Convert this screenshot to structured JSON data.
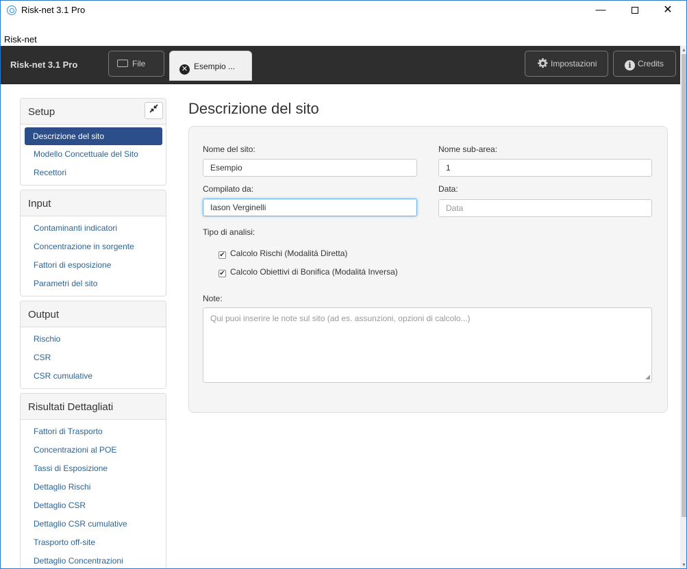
{
  "window": {
    "title": "Risk-net 3.1 Pro",
    "minimize": "—",
    "close": "✕"
  },
  "menubar": {
    "label": "Risk-net"
  },
  "toolbar": {
    "brand": "Risk-net 3.1 Pro",
    "file_label": "File",
    "active_tab_label": "Esempio ...",
    "settings_label": "Impostazioni",
    "credits_label": "Credits"
  },
  "sidebar": {
    "collapse_icon": "compress-arrows-icon",
    "panels": [
      {
        "title": "Setup",
        "items": [
          "Descrizione del sito",
          "Modello Concettuale del Sito",
          "Recettori"
        ]
      },
      {
        "title": "Input",
        "items": [
          "Contaminanti indicatori",
          "Concentrazione in sorgente",
          "Fattori di esposizione",
          "Parametri del sito"
        ]
      },
      {
        "title": "Output",
        "items": [
          "Rischio",
          "CSR",
          "CSR cumulative"
        ]
      },
      {
        "title": "Risultati Dettagliati",
        "items": [
          "Fattori di Trasporto",
          "Concentrazioni al POE",
          "Tassi di Esposizione",
          "Dettaglio Rischi",
          "Dettaglio CSR",
          "Dettaglio CSR cumulative",
          "Trasporto off-site",
          "Dettaglio Concentrazioni"
        ]
      }
    ],
    "active_item": "Descrizione del sito"
  },
  "main": {
    "title": "Descrizione del sito",
    "site_name_label": "Nome del sito:",
    "site_name_value": "Esempio",
    "subarea_label": "Nome sub-area:",
    "subarea_value": "1",
    "compiled_by_label": "Compilato da:",
    "compiled_by_value": "Iason Verginelli",
    "date_label": "Data:",
    "date_placeholder": "Data",
    "analysis_type_label": "Tipo di analisi:",
    "check_forward_label": "Calcolo Rischi (Modalitá Diretta)",
    "check_forward_checked": true,
    "check_inverse_label": "Calcolo Obiettivi di Bonifica (Modalitá Inversa)",
    "check_inverse_checked": true,
    "notes_label": "Note:",
    "notes_placeholder": "Qui puoi inserire le note sul sito (ad es. assunzioni, opzioni di calcolo...)"
  },
  "colors": {
    "toolbar_bg": "#2e2e2e",
    "active_item_bg": "#2c4e8a",
    "link": "#2a6496",
    "focus_border": "#66afe9"
  }
}
